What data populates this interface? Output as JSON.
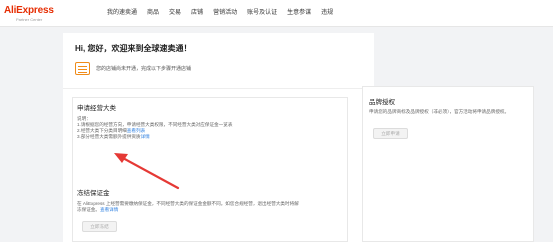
{
  "logo": {
    "main": "AliExpress",
    "sub": "Partner Center"
  },
  "nav": [
    "我的速卖通",
    "商品",
    "交易",
    "店铺",
    "营销活动",
    "账号及认证",
    "生意参谋",
    "违规"
  ],
  "welcome": "Hi, 您好，欢迎来到全球速卖通！",
  "notice": "您的店铺尚未开通，完成以下步骤开通店铺",
  "apply_card": {
    "title": "申请经营大类",
    "lines": [
      {
        "text": "说明：",
        "link": ""
      },
      {
        "text": "1.请根据您的经营方向，申请经营大类权限，不同经营大类对应保证金一览表",
        "link": ""
      },
      {
        "text": "2.经营大类下分类目明细",
        "link": "查看列表"
      },
      {
        "text": "3.部分经营大类需额外提供资质",
        "link": "详情"
      }
    ],
    "button": "立即申请"
  },
  "brand_card": {
    "title": "品牌授权",
    "text": "申请您的品牌商标及品牌授权（非必须），官方活动将申请品牌授权。",
    "button": "立即申请"
  },
  "deposit_card": {
    "title": "冻结保证金",
    "line1": "在 AliExpress 上经营需要缴纳保证金，不同经营大类的保证金金额不同。如您合规经营，退出经营大类时将解",
    "line2": "冻保证金。",
    "line2_link": "查看详情",
    "button": "立即冻结"
  },
  "colors": {
    "brand": "#e62e04",
    "accent": "#f24b4b",
    "link": "#2d7fe0",
    "notice": "#f08c1a"
  }
}
